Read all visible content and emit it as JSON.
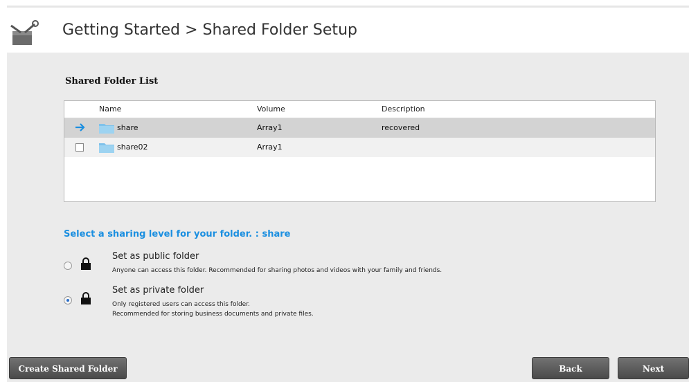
{
  "header": {
    "title": "Getting Started > Shared Folder Setup",
    "logo_icon": "toolbox-wrench-icon"
  },
  "list": {
    "title": "Shared Folder List",
    "columns": [
      "Name",
      "Volume",
      "Description"
    ],
    "rows": [
      {
        "name": "share",
        "volume": "Array1",
        "description": "recovered",
        "selected": true
      },
      {
        "name": "share02",
        "volume": "Array1",
        "description": "",
        "selected": false
      }
    ]
  },
  "sharing": {
    "instruction": "Select a sharing level for your folder. : share",
    "options": [
      {
        "label": "Set as public folder",
        "description": [
          "Anyone can access this folder. Recommended for sharing photos and videos with your family and friends."
        ],
        "checked": false
      },
      {
        "label": "Set as private folder",
        "description": [
          "Only registered users can access this folder.",
          "Recommended for storing business documents and private files."
        ],
        "checked": true
      }
    ]
  },
  "buttons": {
    "create": "Create Shared Folder",
    "back": "Back",
    "next": "Next"
  },
  "colors": {
    "accent": "#1b8fe0",
    "panel_bg": "#ebebeb",
    "selected_row": "#d3d3d3",
    "button_bg": "#5a5a5a"
  }
}
